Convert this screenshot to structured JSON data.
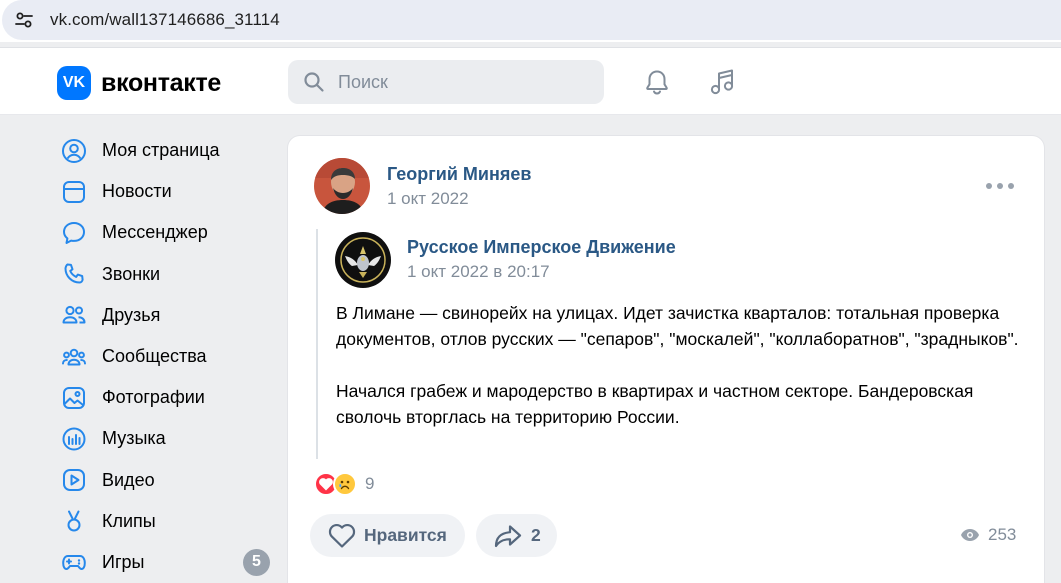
{
  "browser": {
    "url": "vk.com/wall137146686_31114",
    "site_info_icon": "tune-icon"
  },
  "header": {
    "logo_mark": "VK",
    "logo_text": "вконтакте",
    "search_placeholder": "Поиск",
    "icons": [
      "bell-icon",
      "music-icon"
    ]
  },
  "sidebar": {
    "items": [
      {
        "label": "Моя страница",
        "icon": "user-circle-icon"
      },
      {
        "label": "Новости",
        "icon": "news-icon"
      },
      {
        "label": "Мессенджер",
        "icon": "message-icon"
      },
      {
        "label": "Звонки",
        "icon": "phone-icon"
      },
      {
        "label": "Друзья",
        "icon": "friends-icon"
      },
      {
        "label": "Сообщества",
        "icon": "communities-icon"
      },
      {
        "label": "Фотографии",
        "icon": "photo-icon"
      },
      {
        "label": "Музыка",
        "icon": "music-bars-icon"
      },
      {
        "label": "Видео",
        "icon": "video-icon"
      },
      {
        "label": "Клипы",
        "icon": "clips-icon"
      },
      {
        "label": "Игры",
        "icon": "gamepad-icon",
        "badge": "5"
      }
    ]
  },
  "post": {
    "author": "Георгий Миняев",
    "date": "1 окт 2022",
    "repost": {
      "author": "Русское Имперское Движение",
      "date": "1 окт 2022 в 20:17",
      "paragraphs": [
        "В Лимане — свинорейх на улицах. Идет зачистка кварталов: тотальная проверка документов, отлов русских — \"сепаров\", \"москалей\", \"коллаборатнов\", \"зрадныков\".",
        "Начался грабеж и мародерство в квартирах и частном секторе. Бандеровская сволочь вторглась на территорию России."
      ]
    },
    "reactions": {
      "count": "9",
      "types": [
        "heart",
        "sad"
      ]
    },
    "like_label": "Нравится",
    "share_count": "2",
    "views": "253"
  },
  "colors": {
    "accent": "#0077ff",
    "link": "#2a5885",
    "muted": "#818c99",
    "icon": "#2688eb"
  }
}
